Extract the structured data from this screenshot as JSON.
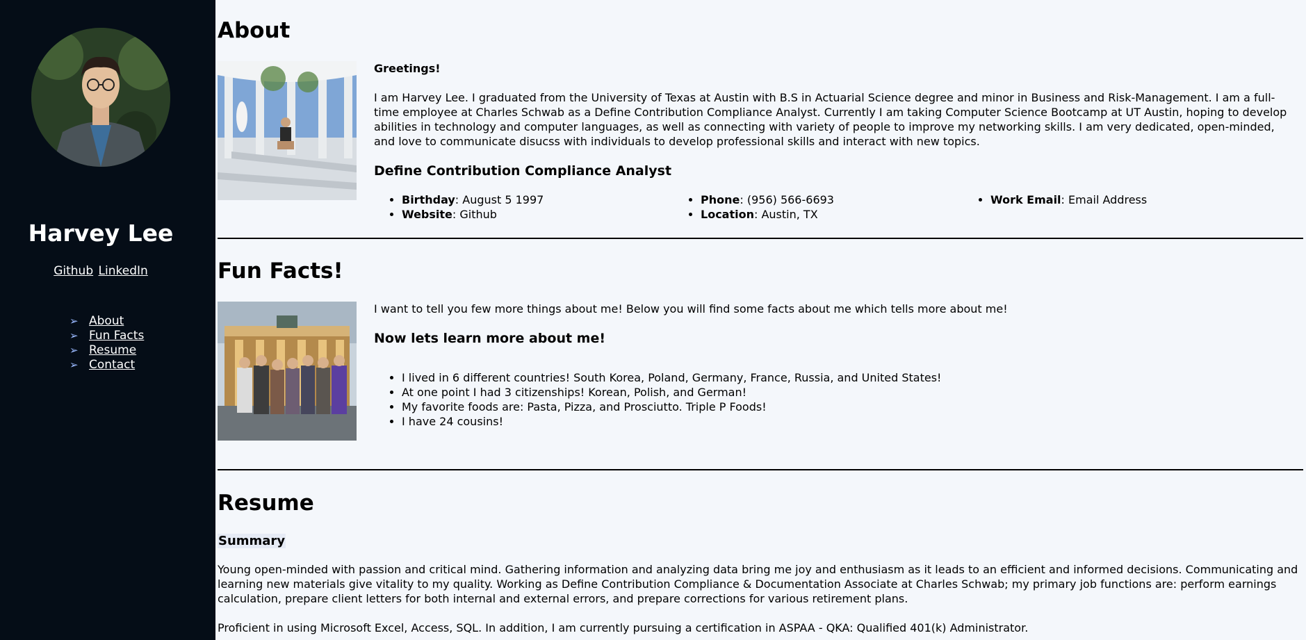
{
  "sidebar": {
    "name": "Harvey Lee",
    "links": {
      "github": "Github",
      "linkedin": "LinkedIn"
    },
    "nav": [
      {
        "arrow": "➢",
        "label": "About"
      },
      {
        "arrow": "➢",
        "label": "Fun Facts"
      },
      {
        "arrow": "➢",
        "label": "Resume"
      },
      {
        "arrow": "➢",
        "label": "Contact"
      }
    ],
    "colors": {
      "background": "#050d17",
      "arrow": "#9ab9ff"
    }
  },
  "about": {
    "heading": "About",
    "greeting": "Greetings!",
    "paragraph": "I am Harvey Lee. I graduated from the University of Texas at Austin with B.S in Actuarial Science degree and minor in Business and Risk-Management. I am a full-time employee at Charles Schwab as a Define Contribution Compliance Analyst. Currently I am taking Computer Science Bootcamp at UT Austin, hoping to develop abilities in technology and computer languages, as well as connecting with variety of people to improve my networking skills. I am very dedicated, open-minded, and love to communicate disucss with individuals to develop professional skills and interact with new topics.",
    "job_title": "Define Contribution Compliance Analyst",
    "info": {
      "birthday_label": "Birthday",
      "birthday": ": August 5 1997",
      "website_label": "Website",
      "website": ": Github",
      "phone_label": "Phone",
      "phone": ": (956) 566-6693",
      "location_label": "Location",
      "location": ": Austin, TX",
      "email_label": "Work Email",
      "email": ": Email Address"
    }
  },
  "fun_facts": {
    "heading": "Fun Facts!",
    "intro": "I want to tell you few more things about me! Below you will find some facts about me which tells more about me!",
    "subheading": "Now lets learn more about me!",
    "facts": [
      "I lived in 6 different countries! South Korea, Poland, Germany, France, Russia, and United States!",
      "At one point I had 3 citizenships! Korean, Polish, and German!",
      "My favorite foods are: Pasta, Pizza, and Prosciutto. Triple P Foods!",
      "I have 24 cousins!"
    ]
  },
  "resume": {
    "heading": "Resume",
    "summary_title": "Summary",
    "summary": "Young open-minded with passion and critical mind. Gathering information and analyzing data bring me joy and enthusiasm as it leads to an efficient and informed decisions. Communicating and learning new materials give vitality to my quality. Working as Define Contribution Compliance & Documentation Associate at Charles Schwab; my primary job functions are: perform earnings calculation, prepare client letters for both internal and external errors, and prepare corrections for various retirement plans.",
    "skills": "Proficient in using Microsoft Excel, Access, SQL. In addition, I am currently pursuing a certification in ASPAA - QKA: Qualified 401(k) Administrator."
  }
}
